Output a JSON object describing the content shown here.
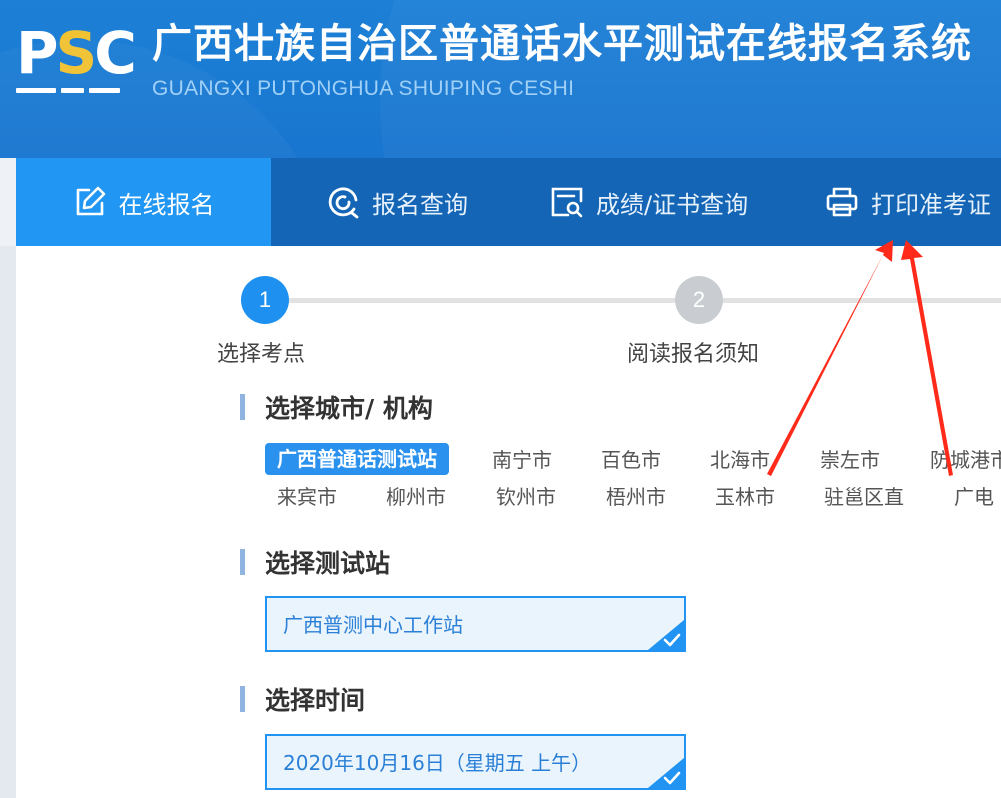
{
  "header": {
    "logo_parts": [
      "P",
      "S",
      "C"
    ],
    "title": "广西壮族自治区普通话水平测试在线报名系统",
    "subtitle": "GUANGXI PUTONGHUA SHUIPING CESHI",
    "colors": {
      "background": "#1a7ad2",
      "logo_accent": "#f1c232"
    }
  },
  "nav": {
    "items": [
      {
        "label": "在线报名",
        "icon": "edit-icon",
        "active": true
      },
      {
        "label": "报名查询",
        "icon": "search-refresh-icon",
        "active": false
      },
      {
        "label": "成绩/证书查询",
        "icon": "certificate-search-icon",
        "active": false
      },
      {
        "label": "打印准考证",
        "icon": "printer-icon",
        "active": false
      }
    ],
    "colors": {
      "background": "#1465b5",
      "active": "#2196f3"
    }
  },
  "steps": [
    {
      "number": "1",
      "label": "选择考点",
      "active": true
    },
    {
      "number": "2",
      "label": "阅读报名须知",
      "active": false
    }
  ],
  "sections": {
    "city": {
      "title": "选择城市/ 机构",
      "options_row1": [
        "广西普通话测试站",
        "南宁市",
        "百色市",
        "北海市",
        "崇左市",
        "防城港市"
      ],
      "options_row2": [
        "来宾市",
        "柳州市",
        "钦州市",
        "梧州市",
        "玉林市",
        "驻邕区直",
        "广电"
      ],
      "selected": "广西普通话测试站"
    },
    "station": {
      "title": "选择测试站",
      "value": "广西普测中心工作站"
    },
    "time": {
      "title": "选择时间",
      "value": "2020年10月16日（星期五 上午）"
    }
  },
  "annotation": {
    "color": "#ff2a1a"
  }
}
